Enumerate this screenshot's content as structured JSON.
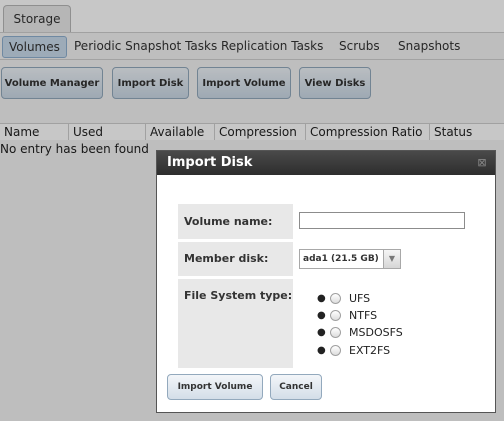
{
  "top_tab": {
    "label": "Storage"
  },
  "sub_tabs": [
    {
      "label": "Volumes"
    },
    {
      "label": "Periodic Snapshot Tasks"
    },
    {
      "label": "Replication Tasks"
    },
    {
      "label": "Scrubs"
    },
    {
      "label": "Snapshots"
    }
  ],
  "toolbar": {
    "volume_manager": "Volume Manager",
    "import_disk": "Import Disk",
    "import_volume": "Import Volume",
    "view_disks": "View Disks"
  },
  "grid": {
    "columns": [
      "Name",
      "Used",
      "Available",
      "Compression",
      "Compression Ratio",
      "Status"
    ],
    "empty_message": "No entry has been found"
  },
  "dialog": {
    "title": "Import Disk",
    "close_glyph": "⊠",
    "volume_name_label": "Volume name:",
    "volume_name_value": "",
    "member_disk_label": "Member disk:",
    "member_disk_value": "ada1 (21.5 GB)",
    "fs_type_label": "File System type:",
    "fs_options": [
      "UFS",
      "NTFS",
      "MSDOSFS",
      "EXT2FS"
    ],
    "import_button": "Import Volume",
    "cancel_button": "Cancel"
  }
}
